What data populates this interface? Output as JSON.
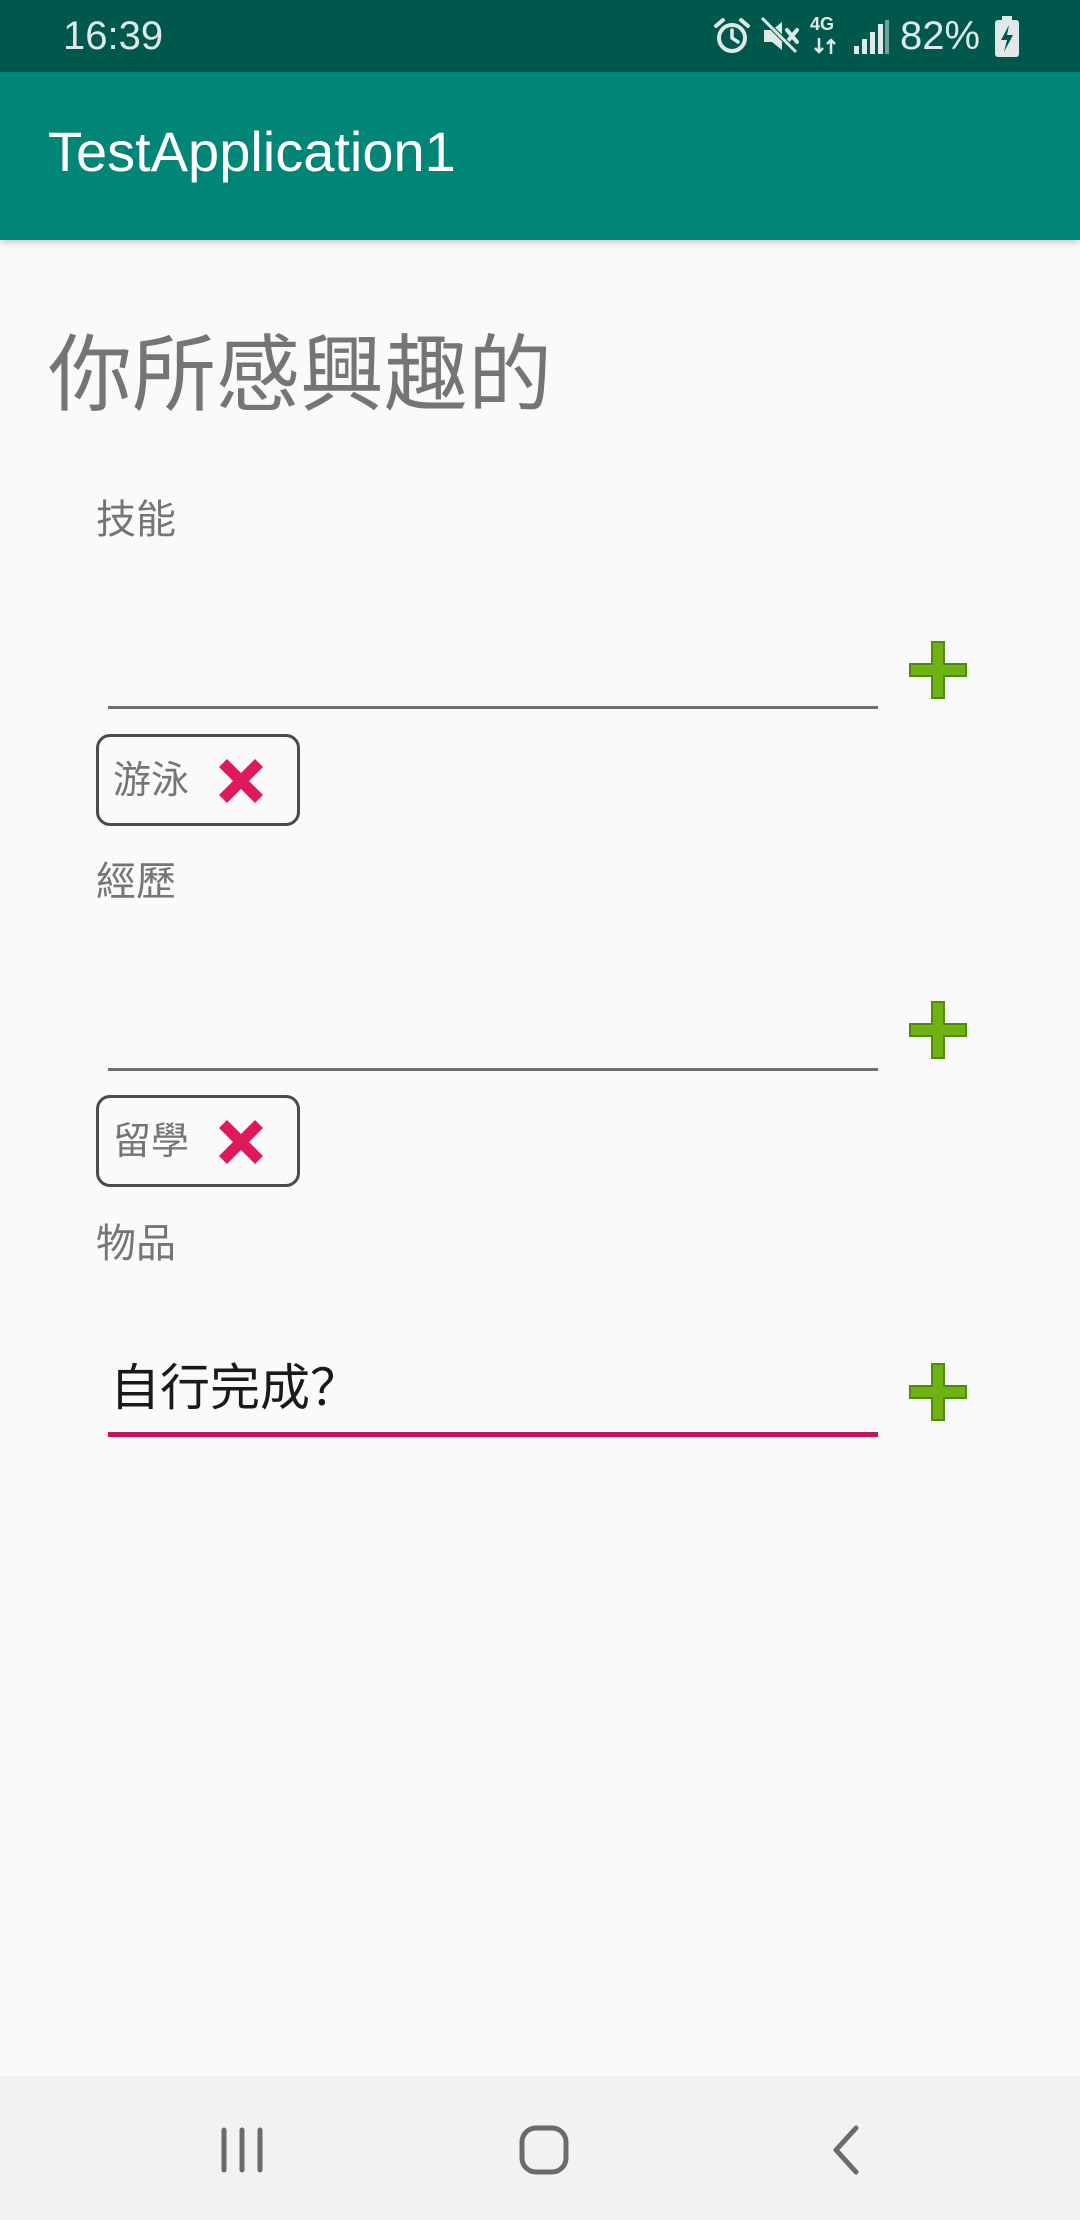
{
  "status_bar": {
    "time": "16:39",
    "network_type": "4G",
    "battery_percent": "82%",
    "icons": [
      "alarm-icon",
      "mute-icon",
      "network-4g-icon",
      "signal-icon",
      "battery-charging-icon"
    ]
  },
  "app_bar": {
    "title": "TestApplication1"
  },
  "page": {
    "heading": "你所感興趣的"
  },
  "sections": [
    {
      "label": "技能",
      "input_value": "",
      "chips": [
        {
          "label": "游泳"
        }
      ]
    },
    {
      "label": "經歷",
      "input_value": "",
      "chips": [
        {
          "label": "留學"
        }
      ]
    },
    {
      "label": "物品",
      "input_value": "自行完成？",
      "chips": []
    }
  ],
  "colors": {
    "status_bar": "#00574b",
    "app_bar": "#008577",
    "accent": "#c2185b",
    "add_icon": "#6fb214",
    "remove_icon": "#e0195a",
    "background": "#fafafa"
  },
  "nav_bar": {
    "icons": [
      "recent-apps-icon",
      "home-icon",
      "back-icon"
    ]
  }
}
